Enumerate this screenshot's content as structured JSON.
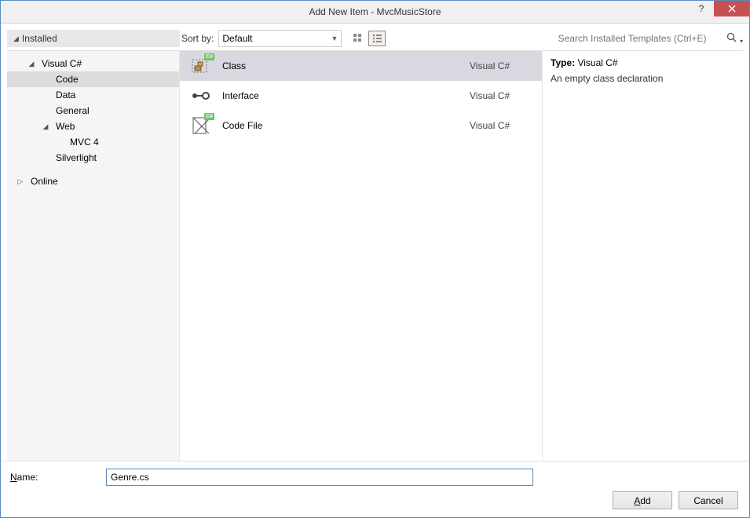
{
  "title": "Add New Item - MvcMusicStore",
  "sidebar": {
    "header": "Installed",
    "items": [
      {
        "label": "Visual C#",
        "expanded": true,
        "level": 1
      },
      {
        "label": "Code",
        "expanded": null,
        "level": 2,
        "selected": true
      },
      {
        "label": "Data",
        "expanded": null,
        "level": 2
      },
      {
        "label": "General",
        "expanded": null,
        "level": 2
      },
      {
        "label": "Web",
        "expanded": true,
        "level": 2
      },
      {
        "label": "MVC 4",
        "expanded": null,
        "level": 3
      },
      {
        "label": "Silverlight",
        "expanded": null,
        "level": 2
      }
    ],
    "online": "Online"
  },
  "sortby": {
    "label": "Sort by:",
    "value": "Default"
  },
  "search": {
    "placeholder": "Search Installed Templates (Ctrl+E)"
  },
  "templates": [
    {
      "name": "Class",
      "lang": "Visual C#",
      "selected": true,
      "icon": "class"
    },
    {
      "name": "Interface",
      "lang": "Visual C#",
      "selected": false,
      "icon": "interface"
    },
    {
      "name": "Code File",
      "lang": "Visual C#",
      "selected": false,
      "icon": "codefile"
    }
  ],
  "description": {
    "type_label": "Type:",
    "type_value": "Visual C#",
    "text": "An empty class declaration"
  },
  "name_field": {
    "label_prefix": "N",
    "label_rest": "ame:",
    "value": "Genre.cs"
  },
  "buttons": {
    "add_prefix": "A",
    "add_rest": "dd",
    "cancel": "Cancel"
  }
}
